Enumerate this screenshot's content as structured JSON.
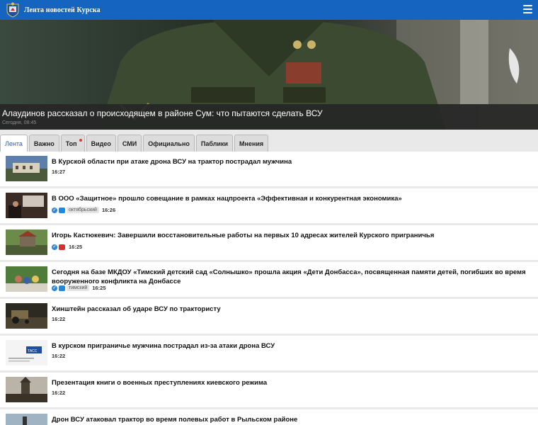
{
  "header": {
    "site_title": "Лента новостей Курска",
    "logo_icon": "coat-of-arms-icon",
    "menu_icon": "hamburger-menu-icon",
    "bg_color": "#1565c0"
  },
  "hero": {
    "title": "Алаудинов рассказал о происходящем в районе Сум: что пытаются сделать ВСУ",
    "time": "Сегодня, 08:45"
  },
  "tabs": [
    {
      "label": "Лента",
      "active": true
    },
    {
      "label": "Важно"
    },
    {
      "label": "Топ",
      "has_dot": true
    },
    {
      "label": "Видео"
    },
    {
      "label": "СМИ"
    },
    {
      "label": "Официально"
    },
    {
      "label": "Паблики"
    },
    {
      "label": "Мнения"
    }
  ],
  "news": [
    {
      "title": "В Курской области при атаке дрона ВСУ на трактор пострадал мужчина",
      "time": "16:27"
    },
    {
      "title": "В ООО «Защитное» прошло совещание в рамках нацпроекта «Эффективная и конкурентная экономика»",
      "district": "октябрьский",
      "time": "16:26",
      "verified": true,
      "badge_color": "#1e88e5"
    },
    {
      "title": "Игорь Кастюкевич: Завершили восстановительные работы на первых 10 адресах жителей Курского приграничья",
      "time": "16:25",
      "verified": true,
      "badge_color": "#d32f2f"
    },
    {
      "title": "Сегодня на базе МКДОУ «Тимский детский сад «Солнышко» прошла акция «Дети Донбасса», посвященная памяти детей, погибших во время вооруженного конфликта на Донбассе",
      "district": "тимский",
      "time": "16:25",
      "verified": true,
      "badge_color": "#1e88e5"
    },
    {
      "title": "Хинштейн рассказал об ударе ВСУ по трактористу",
      "time": "16:22"
    },
    {
      "title": "В курском приграничье мужчина пострадал из-за атаки дрона ВСУ",
      "time": "16:22",
      "thumb_text": "ТАСС"
    },
    {
      "title": "Презентация книги о военных преступлениях киевского режима",
      "time": "16:22"
    },
    {
      "title": "Дрон ВСУ атаковал трактор во время полевых работ в Рыльском районе",
      "time": ""
    }
  ]
}
